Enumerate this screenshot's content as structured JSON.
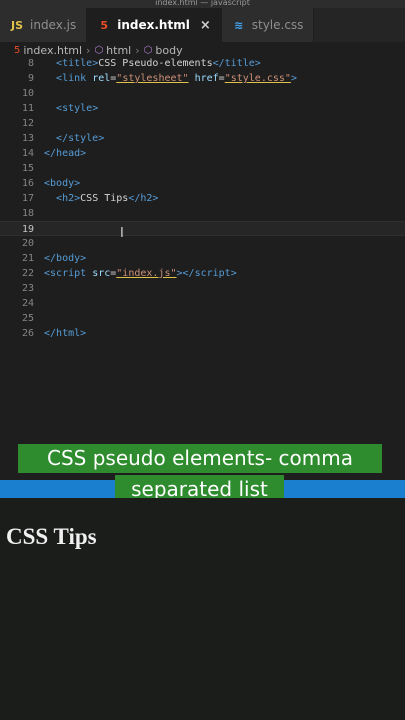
{
  "window": {
    "title": "index.html — javascript"
  },
  "tabs": [
    {
      "label": "index.js",
      "icon": "js-file-icon",
      "glyph": "JS",
      "active": false
    },
    {
      "label": "index.html",
      "icon": "html-file-icon",
      "glyph": "5",
      "active": true,
      "close": "×"
    },
    {
      "label": "style.css",
      "icon": "css-file-icon",
      "glyph": "≋",
      "active": false
    }
  ],
  "breadcrumb": {
    "file": "index.html",
    "html": "html",
    "body": "body",
    "separator": "›"
  },
  "editor": {
    "lines": [
      {
        "num": "8",
        "tokens": [
          [
            "tag",
            "<"
          ],
          [
            "tag",
            "title"
          ],
          [
            "tag",
            ">"
          ],
          [
            "plain",
            "CSS Pseudo-elements"
          ],
          [
            "tag",
            "</"
          ],
          [
            "tag",
            "title"
          ],
          [
            "tag",
            ">"
          ]
        ]
      },
      {
        "num": "9",
        "tokens": [
          [
            "tag",
            "<"
          ],
          [
            "tag",
            "link"
          ],
          [
            "plain",
            " "
          ],
          [
            "attr",
            "rel"
          ],
          [
            "plain",
            "="
          ],
          [
            "str",
            "\"stylesheet\""
          ],
          [
            "plain",
            " "
          ],
          [
            "attr",
            "href"
          ],
          [
            "plain",
            "="
          ],
          [
            "str",
            "\"style.css\""
          ],
          [
            "tag",
            ">"
          ]
        ]
      },
      {
        "num": "10",
        "tokens": []
      },
      {
        "num": "11",
        "tokens": [
          [
            "tag",
            "<"
          ],
          [
            "tag",
            "style"
          ],
          [
            "tag",
            ">"
          ]
        ]
      },
      {
        "num": "12",
        "tokens": []
      },
      {
        "num": "13",
        "tokens": [
          [
            "tag",
            "</"
          ],
          [
            "tag",
            "style"
          ],
          [
            "tag",
            ">"
          ]
        ]
      },
      {
        "num": "14",
        "tokens": [
          [
            "tag",
            "</"
          ],
          [
            "tag",
            "head"
          ],
          [
            "tag",
            ">"
          ]
        ]
      },
      {
        "num": "15",
        "tokens": []
      },
      {
        "num": "16",
        "tokens": [
          [
            "tag",
            "<"
          ],
          [
            "tag",
            "body"
          ],
          [
            "tag",
            ">"
          ]
        ]
      },
      {
        "num": "17",
        "tokens": [
          [
            "tag",
            "<"
          ],
          [
            "tag",
            "h2"
          ],
          [
            "tag",
            ">"
          ],
          [
            "plain",
            "CSS Tips"
          ],
          [
            "tag",
            "</"
          ],
          [
            "tag",
            "h2"
          ],
          [
            "tag",
            ">"
          ]
        ]
      },
      {
        "num": "18",
        "tokens": []
      },
      {
        "num": "19",
        "tokens": [],
        "current": true
      },
      {
        "num": "20",
        "tokens": []
      },
      {
        "num": "21",
        "tokens": [
          [
            "tag",
            "</"
          ],
          [
            "tag",
            "body"
          ],
          [
            "tag",
            ">"
          ]
        ]
      },
      {
        "num": "22",
        "tokens": [
          [
            "tag",
            "<"
          ],
          [
            "tag",
            "script"
          ],
          [
            "plain",
            " "
          ],
          [
            "attr",
            "src"
          ],
          [
            "plain",
            "="
          ],
          [
            "str",
            "\"index.js\""
          ],
          [
            "tag",
            "></"
          ],
          [
            "tag",
            "script"
          ],
          [
            "tag",
            ">"
          ]
        ]
      },
      {
        "num": "23",
        "tokens": []
      },
      {
        "num": "24",
        "tokens": []
      },
      {
        "num": "25",
        "tokens": []
      },
      {
        "num": "26",
        "tokens": [
          [
            "tag",
            "</"
          ],
          [
            "tag",
            "html"
          ],
          [
            "tag",
            ">"
          ]
        ]
      }
    ]
  },
  "captions": {
    "line1": "CSS pseudo elements- comma",
    "line2": "separated list"
  },
  "preview": {
    "heading": "CSS Tips"
  },
  "colors": {
    "accent_bar": "#1b7fcf",
    "caption_bg": "#2e8b2e",
    "tag": "#569cd6",
    "attr": "#9cdcfe",
    "string": "#ce9178"
  }
}
